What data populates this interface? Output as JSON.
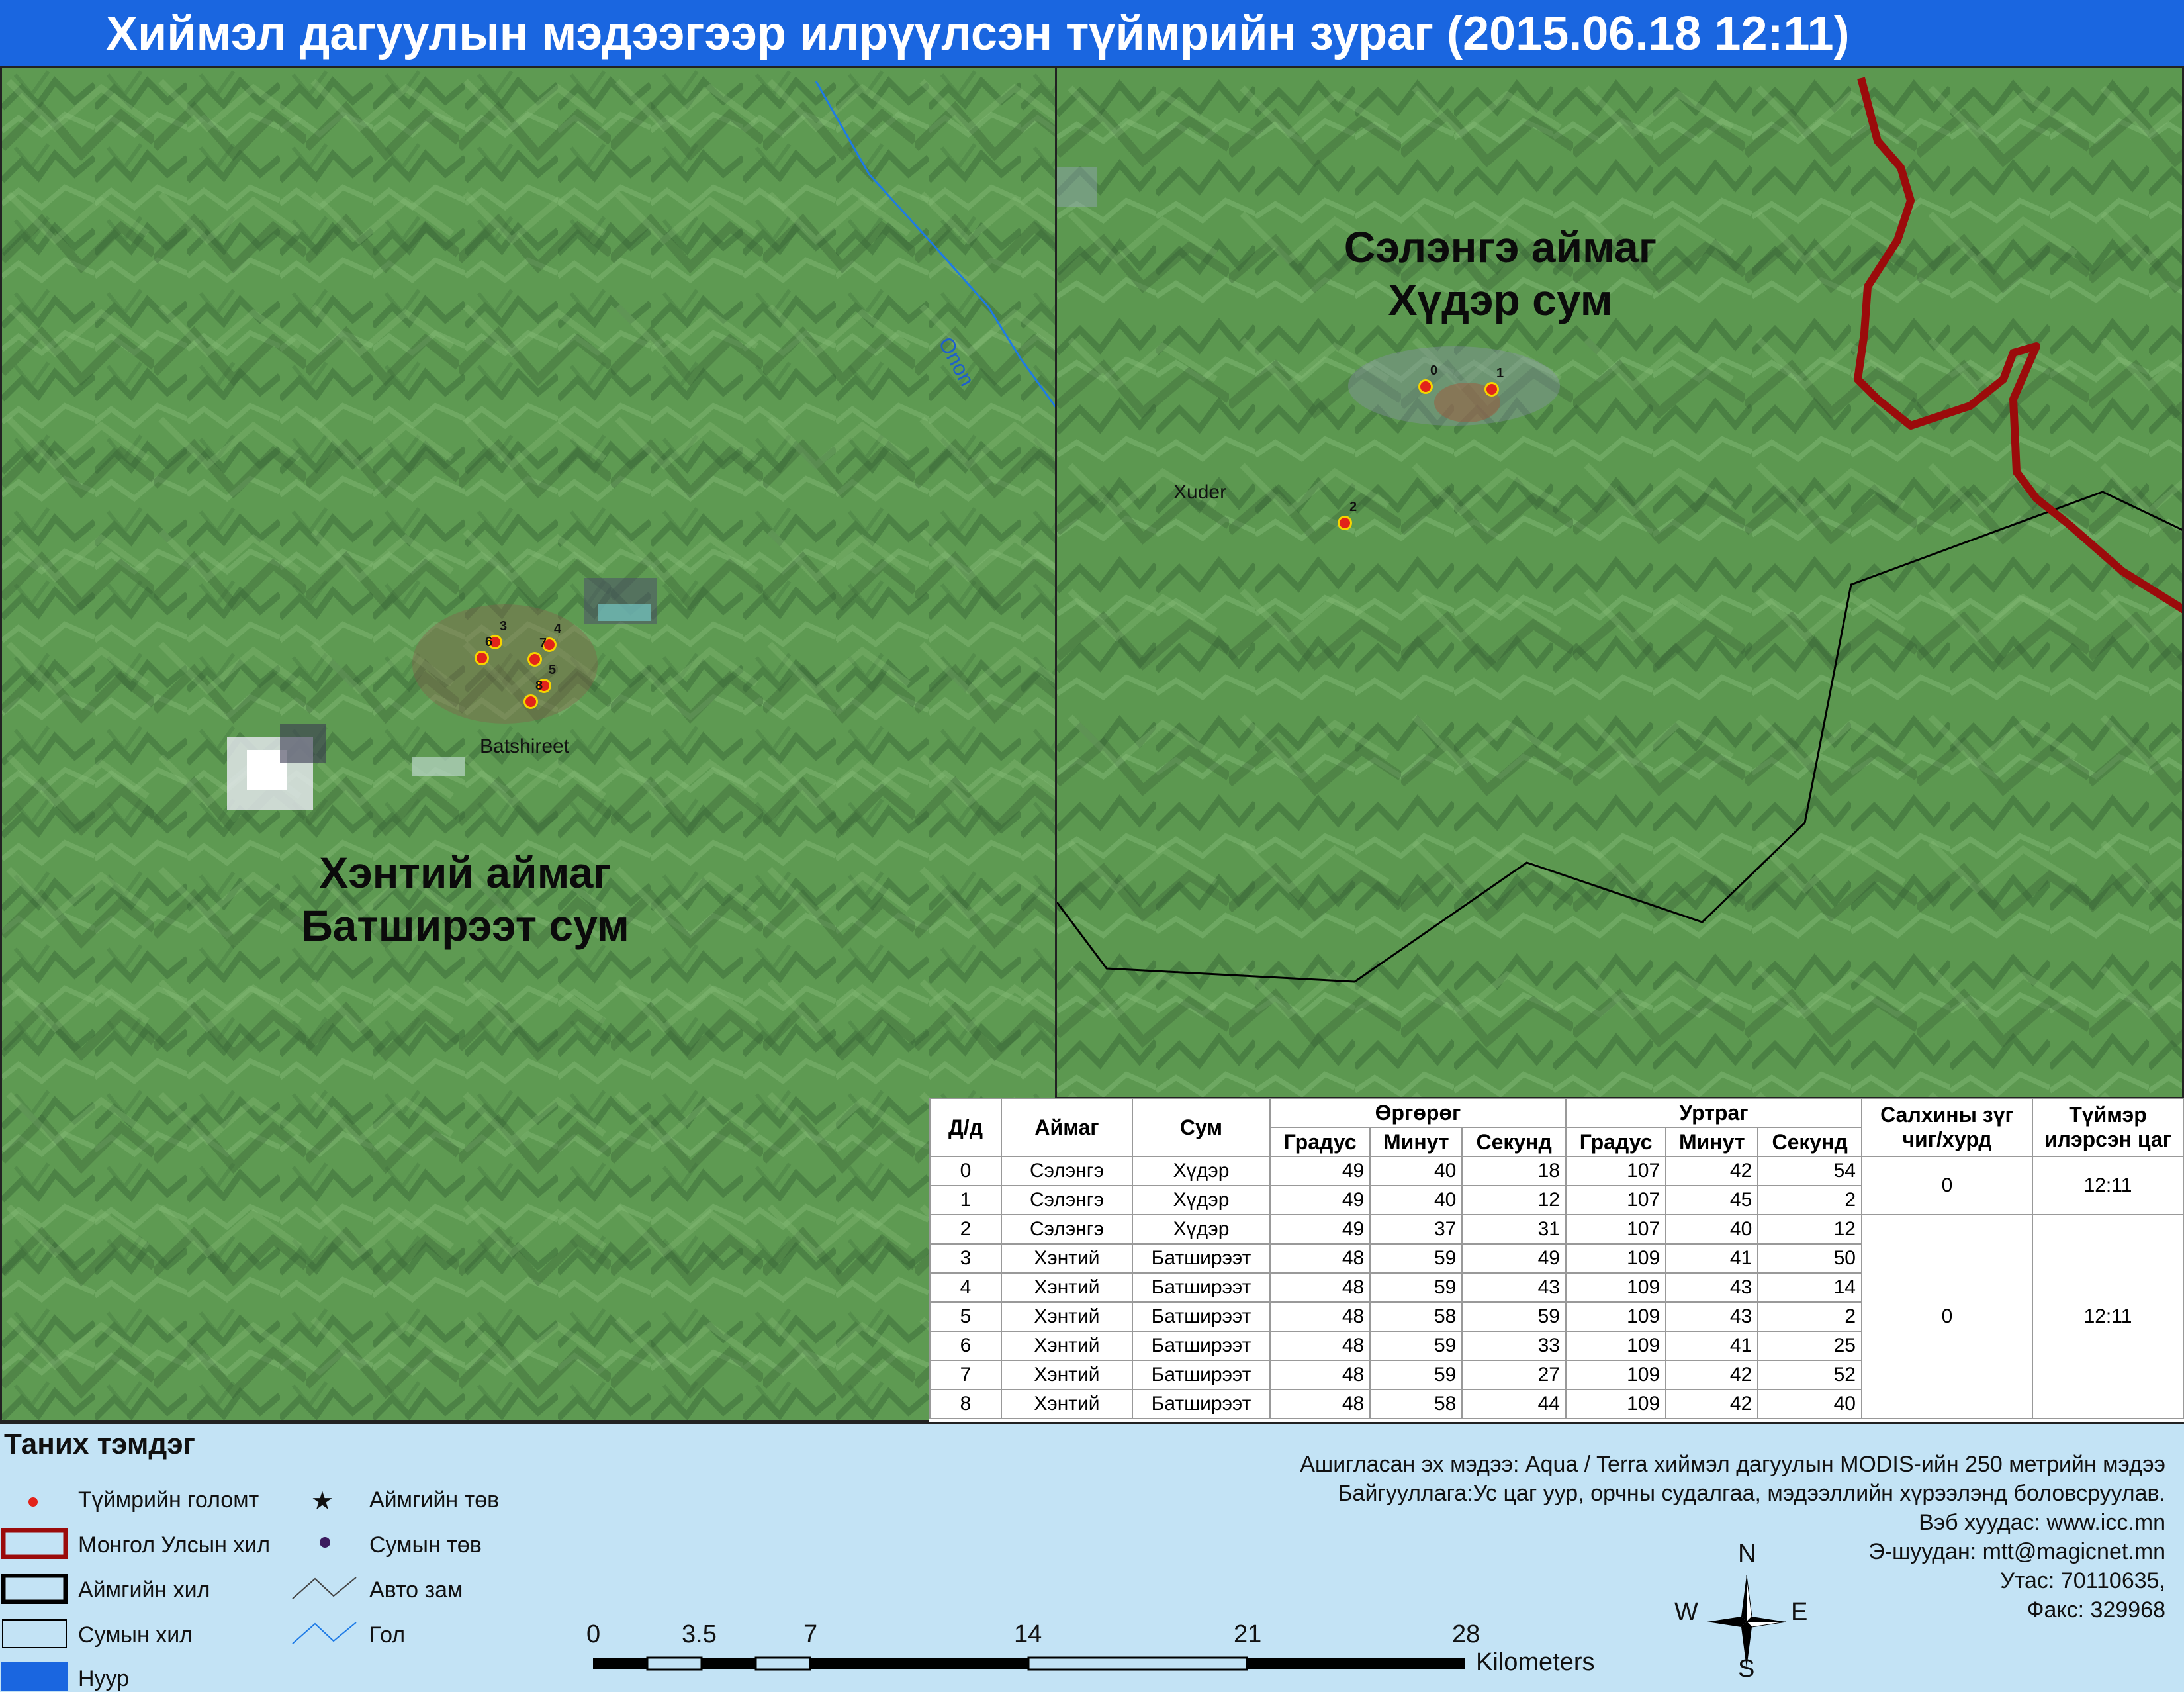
{
  "title": "Хиймэл дагуулын мэдээгээр илрүүлсэн түймрийн зураг  (2015.06.18 12:11)",
  "left_map": {
    "area_label_line1": "Хэнтий  аймаг",
    "area_label_line2": "Батширээт сум",
    "place": "Batshireet",
    "river": "Onon",
    "fire_labels": [
      "3",
      "4",
      "6",
      "7",
      "5",
      "8"
    ]
  },
  "right_map": {
    "area_label_line1": "Сэлэнгэ аймаг",
    "area_label_line2": "Хүдэр сум",
    "place": "Xuder",
    "fire_labels": [
      "0",
      "1",
      "2"
    ]
  },
  "table": {
    "headers": {
      "id": "Д/д",
      "aimag": "Аймаг",
      "sum": "Сум",
      "latitude": "Өргөрөг",
      "longitude": "Уртраг",
      "deg": "Градус",
      "min": "Минут",
      "sec": "Секунд",
      "wind": "Салхины зүг чиг/хурд",
      "time": "Түймэр илэрсэн цаг"
    },
    "rows": [
      {
        "id": "0",
        "aimag": "Сэлэнгэ",
        "sum": "Хүдэр",
        "lat_d": "49",
        "lat_m": "40",
        "lat_s": "18",
        "lon_d": "107",
        "lon_m": "42",
        "lon_s": "54"
      },
      {
        "id": "1",
        "aimag": "Сэлэнгэ",
        "sum": "Хүдэр",
        "lat_d": "49",
        "lat_m": "40",
        "lat_s": "12",
        "lon_d": "107",
        "lon_m": "45",
        "lon_s": "2"
      },
      {
        "id": "2",
        "aimag": "Сэлэнгэ",
        "sum": "Хүдэр",
        "lat_d": "49",
        "lat_m": "37",
        "lat_s": "31",
        "lon_d": "107",
        "lon_m": "40",
        "lon_s": "12"
      },
      {
        "id": "3",
        "aimag": "Хэнтий",
        "sum": "Батширээт",
        "lat_d": "48",
        "lat_m": "59",
        "lat_s": "49",
        "lon_d": "109",
        "lon_m": "41",
        "lon_s": "50"
      },
      {
        "id": "4",
        "aimag": "Хэнтий",
        "sum": "Батширээт",
        "lat_d": "48",
        "lat_m": "59",
        "lat_s": "43",
        "lon_d": "109",
        "lon_m": "43",
        "lon_s": "14"
      },
      {
        "id": "5",
        "aimag": "Хэнтий",
        "sum": "Батширээт",
        "lat_d": "48",
        "lat_m": "58",
        "lat_s": "59",
        "lon_d": "109",
        "lon_m": "43",
        "lon_s": "2"
      },
      {
        "id": "6",
        "aimag": "Хэнтий",
        "sum": "Батширээт",
        "lat_d": "48",
        "lat_m": "59",
        "lat_s": "33",
        "lon_d": "109",
        "lon_m": "41",
        "lon_s": "25"
      },
      {
        "id": "7",
        "aimag": "Хэнтий",
        "sum": "Батширээт",
        "lat_d": "48",
        "lat_m": "59",
        "lat_s": "27",
        "lon_d": "109",
        "lon_m": "42",
        "lon_s": "52"
      },
      {
        "id": "8",
        "aimag": "Хэнтий",
        "sum": "Батширээт",
        "lat_d": "48",
        "lat_m": "58",
        "lat_s": "44",
        "lon_d": "109",
        "lon_m": "42",
        "lon_s": "40"
      }
    ],
    "group1": {
      "wind": "0",
      "time": "12:11"
    },
    "group2": {
      "wind": "0",
      "time": "12:11"
    }
  },
  "legend": {
    "title": "Таних тэмдэг",
    "fire": "Түймрийн голомт",
    "border_national": "Монгол Улсын хил",
    "border_aimag": "Аймгийн хил",
    "border_sum": "Сумын хил",
    "lake": "Нуур",
    "aimag_center": "Аймгийн төв",
    "sum_center": "Сумын төв",
    "road": "Авто зам",
    "river": "Гол"
  },
  "scale": {
    "ticks": [
      "0",
      "3.5",
      "7",
      "14",
      "21",
      "28"
    ],
    "unit": "Kilometers"
  },
  "compass": {
    "n": "N",
    "s": "S",
    "e": "E",
    "w": "W"
  },
  "info": {
    "source": "Ашигласан эх мэдээ: Aqua / Terra хиймэл дагуулын MODIS-ийн 250 метрийн мэдээ",
    "org": "Байгууллага:Ус цаг уур, орчны судалгаа, мэдээллийн хүрээлэнд боловсруулав.",
    "web": "Вэб хуудас: www.icc.mn",
    "email": "Э-шуудан: mtt@magicnet.mn",
    "phone": "Утас: 70110635,",
    "fax": "Факс: 329968"
  },
  "colors": {
    "title_bg": "#1a66e0",
    "terrain": "#5e9a52",
    "fire": "#e2231a",
    "national_border": "#9b0b0b",
    "legend_bg": "#c3e3f5",
    "river": "#1e7be6"
  }
}
